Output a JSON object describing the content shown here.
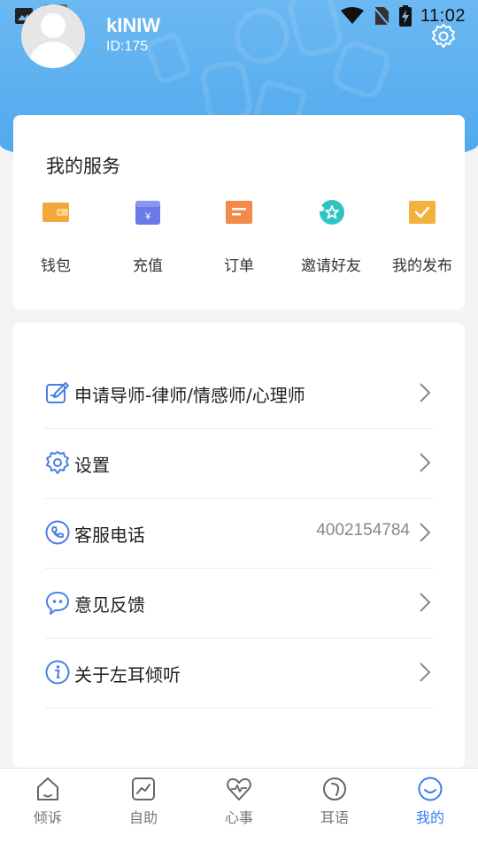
{
  "status_bar": {
    "time": "11:02"
  },
  "profile": {
    "username": "kINIW",
    "user_id": "ID:175"
  },
  "services": {
    "title": "我的服务",
    "items": [
      {
        "label": "钱包",
        "icon": "wallet-icon",
        "color": "#f3a83c"
      },
      {
        "label": "充值",
        "icon": "recharge-icon",
        "color": "#6a7ae8"
      },
      {
        "label": "订单",
        "icon": "order-icon",
        "color": "#f5894a"
      },
      {
        "label": "邀请好友",
        "icon": "invite-icon",
        "color": "#2fc4c4"
      },
      {
        "label": "我的发布",
        "icon": "publish-icon",
        "color": "#f3b23c"
      }
    ]
  },
  "menu": {
    "items": [
      {
        "label": "申请导师-律师/情感师/心理师",
        "icon": "edit-icon",
        "value": ""
      },
      {
        "label": "设置",
        "icon": "settings-icon",
        "value": ""
      },
      {
        "label": "客服电话",
        "icon": "phone-icon",
        "value": "4002154784"
      },
      {
        "label": "意见反馈",
        "icon": "feedback-icon",
        "value": ""
      },
      {
        "label": "关于左耳倾听",
        "icon": "info-icon",
        "value": ""
      }
    ]
  },
  "bottom_nav": {
    "items": [
      {
        "label": "倾诉",
        "icon": "home-icon",
        "active": false
      },
      {
        "label": "自助",
        "icon": "chart-icon",
        "active": false
      },
      {
        "label": "心事",
        "icon": "heartbeat-icon",
        "active": false
      },
      {
        "label": "耳语",
        "icon": "ear-icon",
        "active": false
      },
      {
        "label": "我的",
        "icon": "smile-icon",
        "active": true
      }
    ]
  },
  "colors": {
    "header_blue": "#5aaeef",
    "accent_blue": "#3a7df0",
    "icon_blue": "#4a7ee8"
  }
}
